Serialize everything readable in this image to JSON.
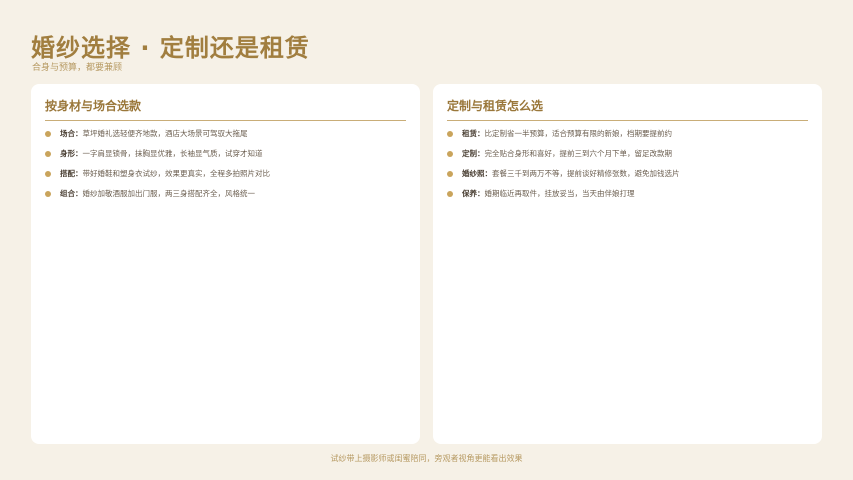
{
  "header": {
    "title": "婚纱选择 · 定制还是租赁",
    "subtitle": "合身与预算，都要兼顾"
  },
  "cards": [
    {
      "title": "按身材与场合选款",
      "items": [
        {
          "label": "场合：",
          "text": "草坪婚礼选轻便齐地款，酒店大场景可驾驭大拖尾"
        },
        {
          "label": "身形：",
          "text": "一字肩显锁骨，抹胸显优雅，长袖显气质，试穿才知道"
        },
        {
          "label": "搭配：",
          "text": "带好婚鞋和塑身衣试纱，效果更真实，全程多拍照片对比"
        },
        {
          "label": "组合：",
          "text": "婚纱加敬酒服加出门服，两三身搭配齐全，风格统一"
        }
      ]
    },
    {
      "title": "定制与租赁怎么选",
      "items": [
        {
          "label": "租赁：",
          "text": "比定制省一半预算，适合预算有限的新娘，档期要提前约"
        },
        {
          "label": "定制：",
          "text": "完全贴合身形和喜好，提前三到六个月下单，留足改款期"
        },
        {
          "label": "婚纱照：",
          "text": "套餐三千到两万不等，提前谈好精修张数，避免加钱选片"
        },
        {
          "label": "保养：",
          "text": "婚期临近再取件，挂放妥当，当天由伴娘打理"
        }
      ]
    }
  ],
  "footer": {
    "text": "试纱带上摄影师或闺蜜陪同，旁观者视角更能看出效果"
  }
}
